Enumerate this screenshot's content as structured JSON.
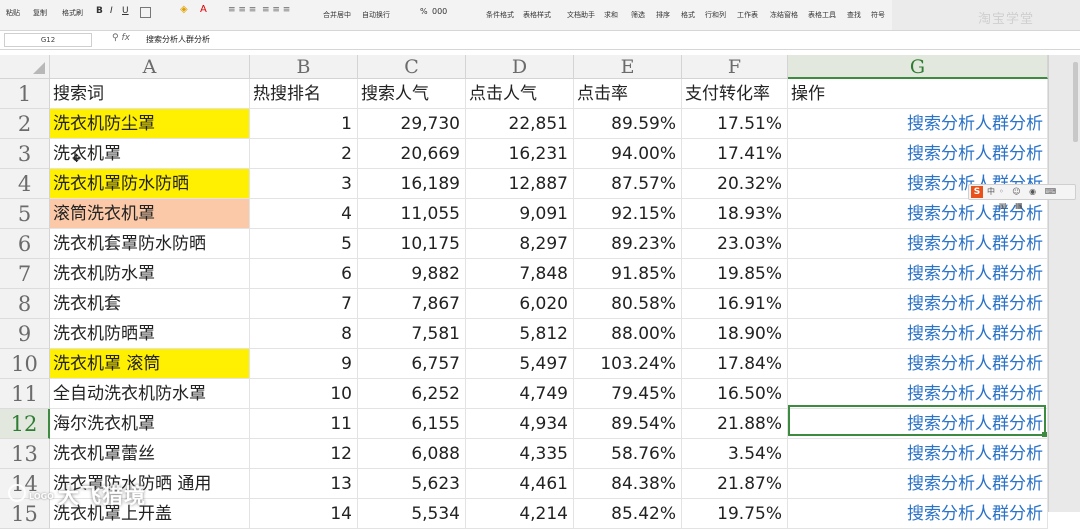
{
  "ribbon": {
    "paste": "粘贴",
    "copy": "复制",
    "format_painter": "格式刷",
    "merge_center": "合并居中",
    "wrap_text": "自动换行",
    "cond_format": "条件格式",
    "table_style": "表格样式",
    "doc_assist": "文档助手",
    "sum": "求和",
    "filter": "筛选",
    "sort": "排序",
    "format": "格式",
    "rows_cols": "行和列",
    "worksheet": "工作表",
    "freeze": "冻结窗格",
    "table_tools": "表格工具",
    "find": "查找",
    "symbol": "符号",
    "percent": "%",
    "thousands": "000",
    "brand_watermark": "淘宝学堂"
  },
  "formula_bar": {
    "name_box": "G12",
    "fx": "fx",
    "content": "搜索分析人群分析"
  },
  "columns": [
    "A",
    "B",
    "C",
    "D",
    "E",
    "F",
    "G"
  ],
  "header_row": {
    "row_num": "1",
    "A": "搜索词",
    "B": "热搜排名",
    "C": "搜索人气",
    "D": "点击人气",
    "E": "点击率",
    "F": "支付转化率",
    "G": "操作"
  },
  "rows": [
    {
      "n": "2",
      "A": "洗衣机防尘罩",
      "B": "1",
      "C": "29,730",
      "D": "22,851",
      "E": "89.59%",
      "F": "17.51%",
      "G": "搜索分析人群分析",
      "hl": "yellow"
    },
    {
      "n": "3",
      "A": "洗衣机罩",
      "B": "2",
      "C": "20,669",
      "D": "16,231",
      "E": "94.00%",
      "F": "17.41%",
      "G": "搜索分析人群分析",
      "hl": ""
    },
    {
      "n": "4",
      "A": "洗衣机罩防水防晒",
      "B": "3",
      "C": "16,189",
      "D": "12,887",
      "E": "87.57%",
      "F": "20.32%",
      "G": "搜索分析人群分析",
      "hl": "yellow"
    },
    {
      "n": "5",
      "A": "滚筒洗衣机罩",
      "B": "4",
      "C": "11,055",
      "D": "9,091",
      "E": "92.15%",
      "F": "18.93%",
      "G": "搜索分析人群分析",
      "hl": "peach"
    },
    {
      "n": "6",
      "A": "洗衣机套罩防水防晒",
      "B": "5",
      "C": "10,175",
      "D": "8,297",
      "E": "89.23%",
      "F": "23.03%",
      "G": "搜索分析人群分析",
      "hl": ""
    },
    {
      "n": "7",
      "A": "洗衣机防水罩",
      "B": "6",
      "C": "9,882",
      "D": "7,848",
      "E": "91.85%",
      "F": "19.85%",
      "G": "搜索分析人群分析",
      "hl": ""
    },
    {
      "n": "8",
      "A": "洗衣机套",
      "B": "7",
      "C": "7,867",
      "D": "6,020",
      "E": "80.58%",
      "F": "16.91%",
      "G": "搜索分析人群分析",
      "hl": ""
    },
    {
      "n": "9",
      "A": "洗衣机防晒罩",
      "B": "8",
      "C": "7,581",
      "D": "5,812",
      "E": "88.00%",
      "F": "18.90%",
      "G": "搜索分析人群分析",
      "hl": ""
    },
    {
      "n": "10",
      "A": "洗衣机罩 滚筒",
      "B": "9",
      "C": "6,757",
      "D": "5,497",
      "E": "103.24%",
      "F": "17.84%",
      "G": "搜索分析人群分析",
      "hl": "yellow"
    },
    {
      "n": "11",
      "A": "全自动洗衣机防水罩",
      "B": "10",
      "C": "6,252",
      "D": "4,749",
      "E": "79.45%",
      "F": "16.50%",
      "G": "搜索分析人群分析",
      "hl": ""
    },
    {
      "n": "12",
      "A": "海尔洗衣机罩",
      "B": "11",
      "C": "6,155",
      "D": "4,934",
      "E": "89.54%",
      "F": "21.88%",
      "G": "搜索分析人群分析",
      "hl": ""
    },
    {
      "n": "13",
      "A": "洗衣机罩蕾丝",
      "B": "12",
      "C": "6,088",
      "D": "4,335",
      "E": "58.76%",
      "F": "3.54%",
      "G": "搜索分析人群分析",
      "hl": ""
    },
    {
      "n": "14",
      "A": "洗衣罩防水防晒 通用",
      "B": "13",
      "C": "5,623",
      "D": "4,461",
      "E": "84.38%",
      "F": "21.87%",
      "G": "搜索分析人群分析",
      "hl": ""
    },
    {
      "n": "15",
      "A": "洗衣机罩上开盖",
      "B": "14",
      "C": "5,534",
      "D": "4,214",
      "E": "85.42%",
      "F": "19.75%",
      "G": "搜索分析人群分析",
      "hl": ""
    }
  ],
  "selected_row": "12",
  "selected_col": "G",
  "ime_toolbar": {
    "logo": "S",
    "mode": "中"
  },
  "watermark": {
    "small": "LOGO",
    "big": "大飞猎境"
  },
  "colors": {
    "yellow": "#ffef00",
    "peach": "#fbc9a8",
    "link": "#2a73c8",
    "selection": "#3d8b40"
  }
}
